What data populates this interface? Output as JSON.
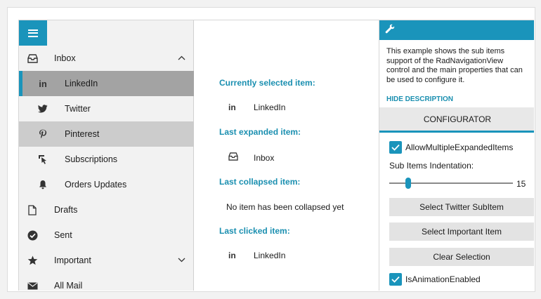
{
  "nav": {
    "items": [
      {
        "label": "Inbox",
        "icon": "inbox-icon"
      },
      {
        "label": "LinkedIn",
        "icon": "linkedin-icon"
      },
      {
        "label": "Twitter",
        "icon": "twitter-icon"
      },
      {
        "label": "Pinterest",
        "icon": "pinterest-icon"
      },
      {
        "label": "Subscriptions",
        "icon": "cursor-icon"
      },
      {
        "label": "Orders Updates",
        "icon": "bell-icon"
      },
      {
        "label": "Drafts",
        "icon": "document-icon"
      },
      {
        "label": "Sent",
        "icon": "check-circle-icon"
      },
      {
        "label": "Important",
        "icon": "star-icon"
      },
      {
        "label": "All Mail",
        "icon": "mail-icon"
      }
    ]
  },
  "content": {
    "selected_title": "Currently selected item:",
    "selected_value": "LinkedIn",
    "expanded_title": "Last expanded item:",
    "expanded_value": "Inbox",
    "collapsed_title": "Last collapsed item:",
    "collapsed_value": "No item has been collapsed yet",
    "clicked_title": "Last clicked item:",
    "clicked_value": "LinkedIn",
    "linkedin_glyph": "in"
  },
  "configurator": {
    "description": [
      "This example shows the sub items",
      "support of the RadNavigationView",
      "control and the main properties that can",
      "be used to configure it."
    ],
    "hide_description": "HIDE DESCRIPTION",
    "title": "CONFIGURATOR",
    "allow_multiple_label": "AllowMultipleExpandedItems",
    "indentation_label": "Sub Items Indentation:",
    "indentation_value": "15",
    "btn_twitter": "Select Twitter SubItem",
    "btn_important": "Select Important Item",
    "btn_clear": "Clear Selection",
    "animation_label": "IsAnimationEnabled"
  },
  "colors": {
    "accent": "#1a94bb",
    "selected_bg": "#a3a3a3",
    "hover_bg": "#cccccc"
  }
}
